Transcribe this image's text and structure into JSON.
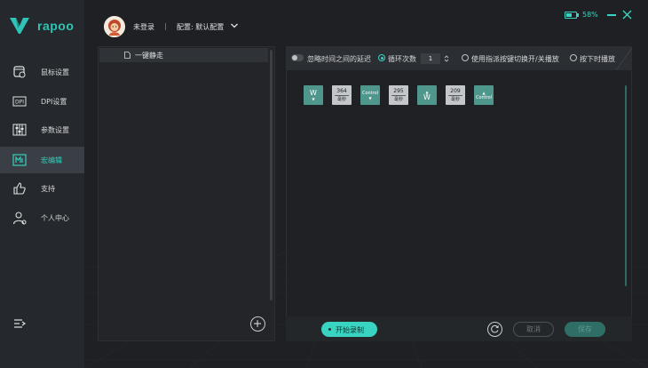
{
  "brand": {
    "logo_text": "rapoo",
    "accent": "#39d3c1"
  },
  "sidebar": {
    "items": [
      {
        "label": "鼠标设置",
        "icon": "mouse-settings-icon"
      },
      {
        "label": "DPI设置",
        "icon": "dpi-icon"
      },
      {
        "label": "参数设置",
        "icon": "parameters-icon"
      },
      {
        "label": "宏编辑",
        "icon": "macro-icon",
        "active": true
      },
      {
        "label": "支持",
        "icon": "thumbs-up-icon"
      },
      {
        "label": "个人中心",
        "icon": "user-icon"
      }
    ],
    "menu_icon": "collapse-menu-icon"
  },
  "header": {
    "login_status": "未登录",
    "separator": "|",
    "config_label": "配置: 默认配置",
    "battery_text": "58%",
    "battery_level": 0.58
  },
  "macro_list": {
    "items": [
      {
        "name": "一键静走"
      }
    ],
    "add_icon": "plus-circle-icon"
  },
  "editor_toolbar": {
    "ignore_delay_label": "忽略时间之间的延迟",
    "loop_label": "循环次数",
    "loop_count": "1",
    "toggle_mode_label": "使用指派按键切换开/关播放",
    "hold_mode_label": "按下时播放"
  },
  "macro_steps": [
    {
      "type": "key",
      "key": "W",
      "direction": "down",
      "arrow": "▼"
    },
    {
      "type": "delay",
      "value": "364",
      "unit": "毫秒"
    },
    {
      "type": "key",
      "key": "Control",
      "direction": "down",
      "arrow": "▼"
    },
    {
      "type": "delay",
      "value": "295",
      "unit": "毫秒"
    },
    {
      "type": "key",
      "key": "W",
      "direction": "up",
      "arrow": "▲"
    },
    {
      "type": "delay",
      "value": "209",
      "unit": "毫秒"
    },
    {
      "type": "key",
      "key": "Control",
      "direction": "up",
      "arrow": "▲"
    }
  ],
  "footer": {
    "record_label": "开始录制",
    "cancel_label": "取消",
    "save_label": "保存"
  }
}
